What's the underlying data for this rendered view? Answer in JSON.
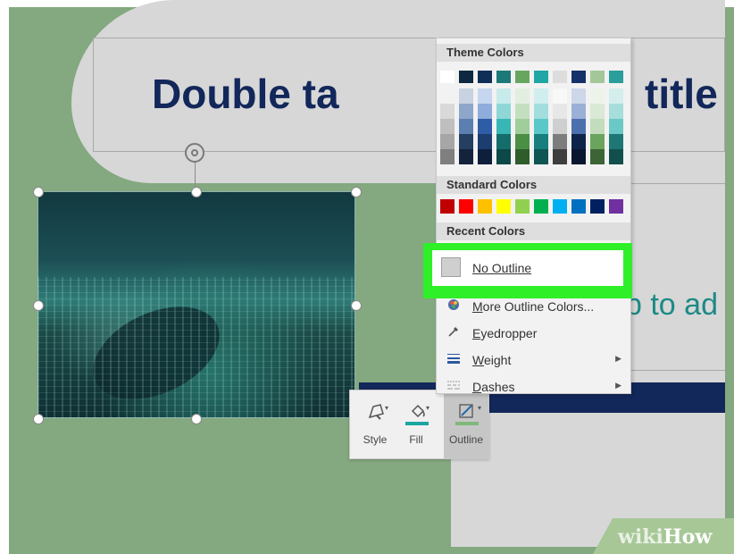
{
  "slide": {
    "title_visible": "Double ta",
    "title_tail": "title",
    "subtitle_visible": "p to ad"
  },
  "mini_toolbar": {
    "buttons": [
      {
        "label": "Style",
        "icon": "shape-style-icon"
      },
      {
        "label": "Fill",
        "icon": "paint-bucket-icon",
        "color": "#19a6a0"
      },
      {
        "label": "Outline",
        "icon": "pen-outline-icon",
        "color": "#7fb87a"
      }
    ]
  },
  "dropdown": {
    "theme_colors_title": "Theme Colors",
    "standard_colors_title": "Standard Colors",
    "recent_colors_title": "Recent Colors",
    "theme_colors": [
      [
        "#ffffff",
        "#f2f2f2",
        "#d9d9d9",
        "#bfbfbf",
        "#a6a6a6",
        "#7f7f7f"
      ],
      [
        "#0e2841",
        "#c8d2e0",
        "#8ea6c9",
        "#5b7fb1",
        "#243f60",
        "#14233c"
      ],
      [
        "#0f2f57",
        "#c6d6ee",
        "#8eaddc",
        "#2f5ca6",
        "#1d3c70",
        "#0d1f3a"
      ],
      [
        "#1b7a78",
        "#c7eaeb",
        "#8fd6d6",
        "#39b7b7",
        "#146c6b",
        "#0c4848"
      ],
      [
        "#68a660",
        "#e2efe0",
        "#c4dfc0",
        "#a0cd9a",
        "#4b8f44",
        "#2f5c2b"
      ],
      [
        "#20a6a4",
        "#d0eeee",
        "#a2dede",
        "#5bc8c8",
        "#197f7d",
        "#0f5554"
      ],
      [
        "#dddddd",
        "#f8f8f8",
        "#e7e7e7",
        "#cfcfcf",
        "#7d7d7d",
        "#3e3e3e"
      ],
      [
        "#14316a",
        "#cdd7ea",
        "#9bb0d6",
        "#4c6fae",
        "#0e2349",
        "#081630"
      ],
      [
        "#a3c799",
        "#ecf4ea",
        "#d9e9d5",
        "#c2dcbc",
        "#6aa45d",
        "#3c6436"
      ],
      [
        "#2a9e9a",
        "#d3eeed",
        "#a7dddb",
        "#6ac9c6",
        "#1e7774",
        "#124f4c"
      ]
    ],
    "standard_colors": [
      "#c00000",
      "#ff0000",
      "#ffc000",
      "#ffff00",
      "#92d050",
      "#00b050",
      "#00b0f0",
      "#0070c0",
      "#002060",
      "#7030a0"
    ],
    "items": [
      {
        "label": "No Outline",
        "icon": "no-outline-swatch-icon"
      },
      {
        "label": "More Outline Colors...",
        "icon": "color-wheel-icon"
      },
      {
        "label": "Eyedropper",
        "icon": "eyedropper-icon"
      },
      {
        "label": "Weight",
        "icon": "line-weight-icon",
        "submenu": true
      },
      {
        "label": "Dashes",
        "icon": "dashes-icon",
        "submenu": true
      }
    ],
    "highlight_color": "#2fef29"
  },
  "watermark": {
    "wiki": "wiki",
    "how": "How"
  }
}
